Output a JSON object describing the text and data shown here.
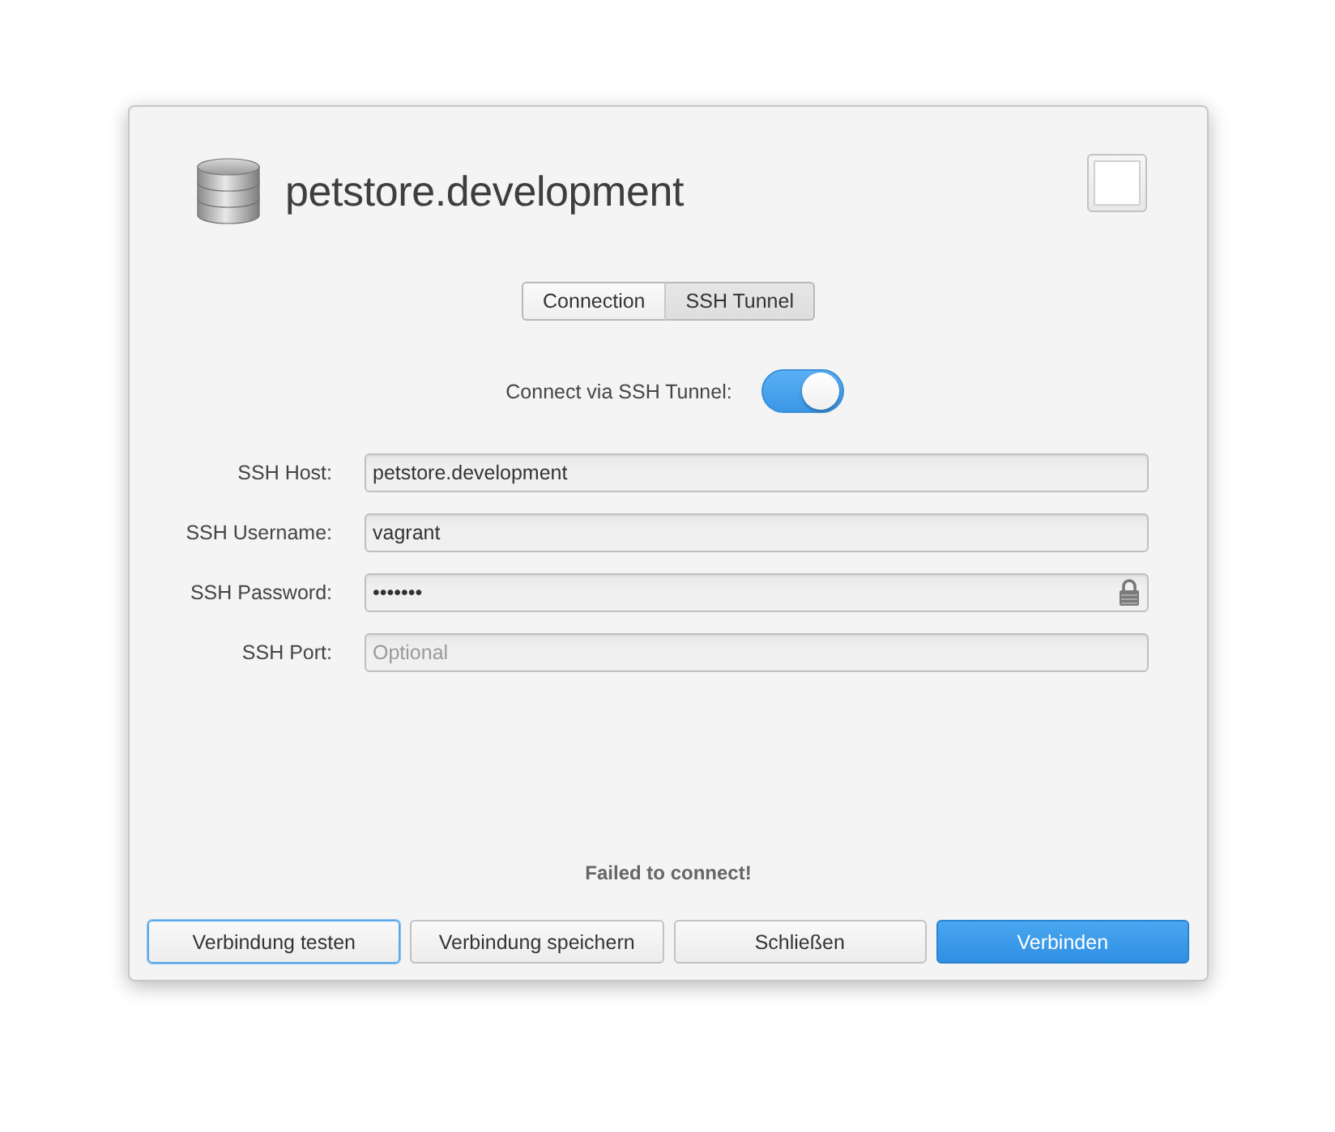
{
  "window": {
    "title": "petstore.development"
  },
  "tabs": [
    {
      "label": "Connection",
      "selected": false
    },
    {
      "label": "SSH Tunnel",
      "selected": true
    }
  ],
  "ssh_tunnel": {
    "label": "Connect via SSH Tunnel:",
    "on": true
  },
  "fields": [
    {
      "kind": "text",
      "label": "SSH Host:",
      "value": "petstore.development"
    },
    {
      "kind": "text",
      "label": "SSH Username:",
      "value": "vagrant"
    },
    {
      "kind": "password",
      "label": "SSH Password:",
      "value": "•••••••"
    },
    {
      "kind": "text",
      "label": "SSH Port:",
      "placeholder": "Optional"
    }
  ],
  "status_message": "Failed to connect!",
  "buttons": [
    {
      "label": "Verbindung testen",
      "kind": "default",
      "focused": true
    },
    {
      "label": "Verbindung speichern",
      "kind": "default",
      "focused": false
    },
    {
      "label": "Schließen",
      "kind": "default",
      "focused": false
    },
    {
      "label": "Verbinden",
      "kind": "primary",
      "focused": false
    }
  ]
}
